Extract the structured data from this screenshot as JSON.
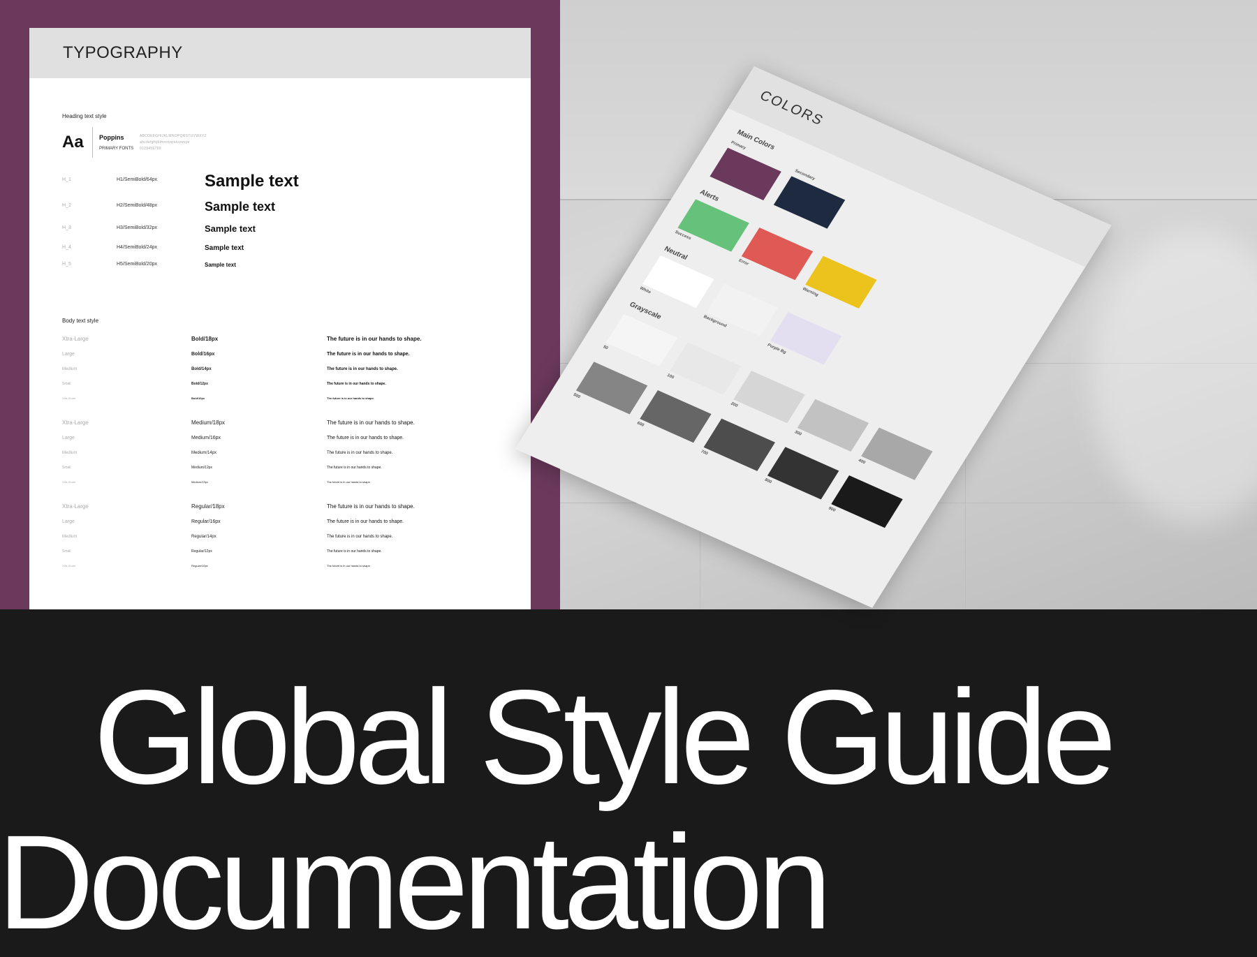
{
  "typography": {
    "title": "TYPOGRAPHY",
    "heading_label": "Heading text style",
    "aa": "Aa",
    "font_name": "Poppins",
    "font_kind": "PRIMARY FONTS",
    "alphabet_upper": "ABCDEFGHIJKLMNOPQRSTUVWXYZ",
    "alphabet_lower": "abcdefghijklmnopqrstuvwxyz",
    "digits": "0123456789",
    "headings": [
      {
        "key": "H_1",
        "spec": "H1/SemiBold/64px",
        "sample": "Sample text"
      },
      {
        "key": "H_2",
        "spec": "H2/SemiBold/48px",
        "sample": "Sample text"
      },
      {
        "key": "H_3",
        "spec": "H3/SemiBold/32px",
        "sample": "Sample text"
      },
      {
        "key": "H_4",
        "spec": "H4/SemiBold/24px",
        "sample": "Sample text"
      },
      {
        "key": "H_5",
        "spec": "H5/SemiBold/20px",
        "sample": "Sample text"
      }
    ],
    "body_label": "Body text style",
    "body_rows": [
      {
        "size": "Xtra-Large",
        "spec": "Bold/18px",
        "sample": "The future is in our hands to shape."
      },
      {
        "size": "Large",
        "spec": "Bold/16px",
        "sample": "The future is in our hands to shape."
      },
      {
        "size": "Medium",
        "spec": "Bold/14px",
        "sample": "The future is in our hands to shape."
      },
      {
        "size": "Small",
        "spec": "Bold/12px",
        "sample": "The future is in our hands to shape."
      },
      {
        "size": "Xtra-Small",
        "spec": "Bold/10px",
        "sample": "The future is in our hands to shape."
      },
      {
        "size": "Xtra-Large",
        "spec": "Medium/18px",
        "sample": "The future is in our hands to shape."
      },
      {
        "size": "Large",
        "spec": "Medium/16px",
        "sample": "The future is in our hands to shape."
      },
      {
        "size": "Medium",
        "spec": "Medium/14px",
        "sample": "The future is in our hands to shape."
      },
      {
        "size": "Small",
        "spec": "Medium/12px",
        "sample": "The future is in our hands to shape."
      },
      {
        "size": "Xtra-Small",
        "spec": "Medium/10px",
        "sample": "The future is in our hands to shape."
      },
      {
        "size": "Xtra-Large",
        "spec": "Regular/18px",
        "sample": "The future is in our hands to shape."
      },
      {
        "size": "Large",
        "spec": "Regular/16px",
        "sample": "The future is in our hands to shape."
      },
      {
        "size": "Medium",
        "spec": "Regular/14px",
        "sample": "The future is in our hands to shape."
      },
      {
        "size": "Small",
        "spec": "Regular/12px",
        "sample": "The future is in our hands to shape."
      },
      {
        "size": "Xtra-Small",
        "spec": "Regular/10px",
        "sample": "The future is in our hands to shape."
      }
    ]
  },
  "colors_sheet": {
    "title": "COLORS",
    "main_colors_label": "Main Colors",
    "primary_label": "Primary",
    "secondary_label": "Secondary",
    "alerts_label": "Alerts",
    "success_label": "Success",
    "error_label": "Error",
    "warning_label": "Warning",
    "neutral_label": "Neutral",
    "white_label": "White",
    "background_label": "Background",
    "purple_bg_label": "Purple Bg",
    "grayscale_label": "Grayscale",
    "grayscale_steps": [
      "50",
      "100",
      "200",
      "300",
      "400",
      "500",
      "600",
      "700",
      "800",
      "900"
    ],
    "swatch_colors": {
      "primary": "#6b395c",
      "secondary": "#1e2a3f",
      "success": "#66c17a",
      "error": "#e05a55",
      "warning": "#ecc21c",
      "white": "#ffffff",
      "background": "#f2f2f2",
      "purple_bg": "#e4dff0",
      "grayscale": [
        "#f5f5f5",
        "#e8e8e8",
        "#d6d6d6",
        "#c2c2c2",
        "#a8a8a8",
        "#858585",
        "#666666",
        "#4d4d4d",
        "#333333",
        "#1a1a1a"
      ]
    }
  },
  "headline": {
    "line1": "Global Style Guide",
    "line2": "Documentation"
  },
  "colors": {
    "left_panel_bg": "#6b395c",
    "bottom_bg": "#1a1a1a",
    "headline_text": "#ffffff"
  }
}
